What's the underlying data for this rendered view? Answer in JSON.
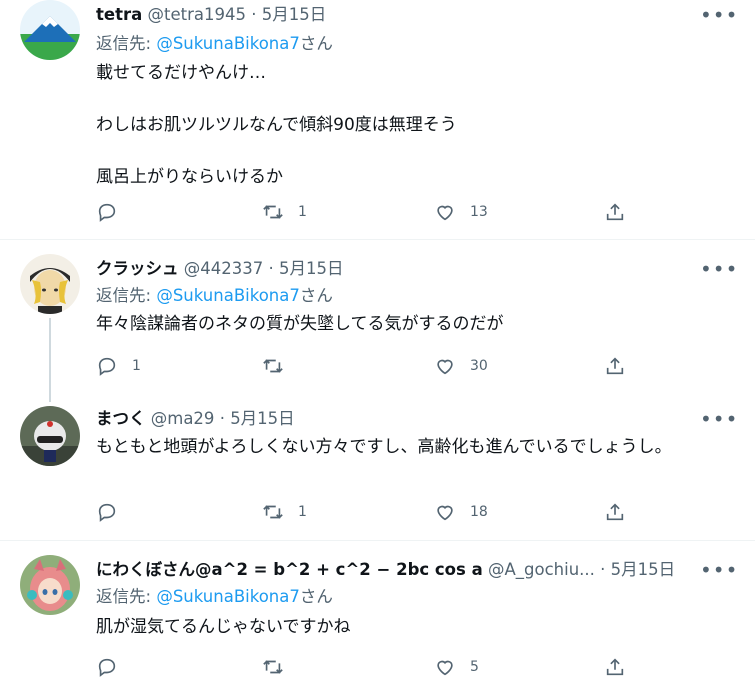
{
  "tweets": [
    {
      "name": "tetra",
      "handle": "@tetra1945",
      "sep": "·",
      "date": "5月15日",
      "reply_prefix": "返信先: ",
      "reply_to": "@SukunaBikona7",
      "reply_suffix": "さん",
      "text": "載せてるだけやんけ…\n\nわしはお肌ツルツルなんで傾斜90度は無理そう\n\n風呂上がりならいけるか",
      "replies": "",
      "retweets": "1",
      "likes": "13"
    },
    {
      "name": "クラッシュ",
      "handle": "@442337",
      "sep": "·",
      "date": "5月15日",
      "reply_prefix": "返信先: ",
      "reply_to": "@SukunaBikona7",
      "reply_suffix": "さん",
      "text": "年々陰謀論者のネタの質が失墜してる気がするのだが",
      "replies": "1",
      "retweets": "",
      "likes": "30"
    },
    {
      "name": "まつく",
      "handle": "@ma29",
      "sep": "·",
      "date": "5月15日",
      "text": "もともと地頭がよろしくない方々ですし、高齢化も進んでいるでしょうし。",
      "replies": "",
      "retweets": "1",
      "likes": "18"
    },
    {
      "name": "にわくぼさん@a^2 = b^2 + c^2 − 2bc cos a",
      "handle": "@A_gochiu...",
      "sep": "·",
      "date": "5月15日",
      "reply_prefix": "返信先: ",
      "reply_to": "@SukunaBikona7",
      "reply_suffix": "さん",
      "text": "肌が湿気てるんじゃないですかね",
      "replies": "",
      "retweets": "",
      "likes": "5"
    }
  ],
  "icons": {
    "reply": "reply-icon",
    "retweet": "retweet-icon",
    "like": "like-icon",
    "share": "share-icon",
    "more": "more-icon"
  },
  "colors": {
    "mention": "#1d9bf0",
    "secondary_text": "#536471",
    "thread_line": "#cfd9de"
  }
}
